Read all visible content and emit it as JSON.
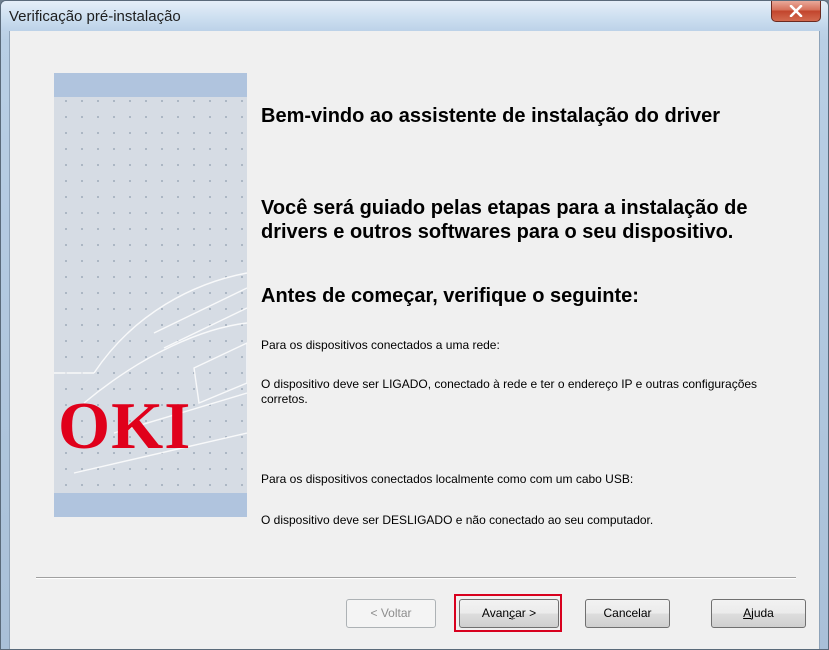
{
  "window": {
    "title": "Verificação pré-instalação"
  },
  "sidebar": {
    "logo_text": "OKI"
  },
  "main": {
    "heading1": "Bem-vindo ao assistente de instalação do driver",
    "heading2": "Você será guiado pelas etapas para a instalação de drivers e outros softwares para o seu dispositivo.",
    "heading3": "Antes de começar, verifique o seguinte:",
    "network_label": "Para os dispositivos conectados a uma rede:",
    "network_text": "O dispositivo deve ser LIGADO, conectado à rede e ter o endereço IP e outras configurações corretos.",
    "local_label": "Para os dispositivos conectados localmente como com um cabo USB:",
    "local_text": "O dispositivo deve ser DESLIGADO e não conectado ao seu computador."
  },
  "buttons": {
    "back": "< Voltar",
    "next_prefix": "Avan",
    "next_underlined": "ç",
    "next_suffix": "ar >",
    "cancel": "Cancelar",
    "help_prefix": "",
    "help_underlined": "A",
    "help_suffix": "juda",
    "back_disabled": true
  },
  "colors": {
    "logo_red": "#e0001b",
    "highlight_red": "#d8001e",
    "panel_band": "#b0c4de"
  },
  "icons": {
    "close": "close-icon"
  }
}
